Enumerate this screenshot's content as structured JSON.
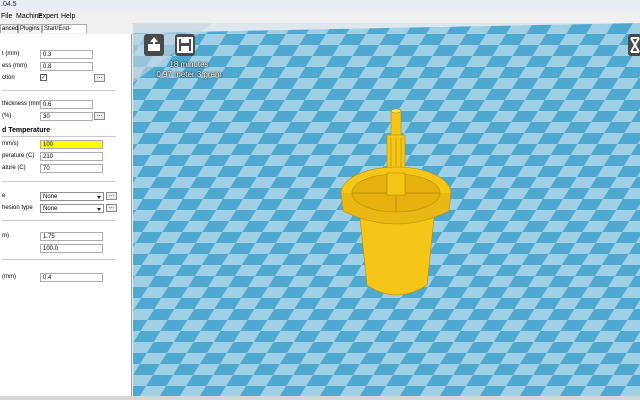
{
  "window": {
    "title": ".04.5"
  },
  "menu": [
    "File",
    "Machine",
    "Expert",
    "Help"
  ],
  "tabs": [
    "anced",
    "Plugins",
    "Start/End-GCode"
  ],
  "settings": {
    "rows": [
      {
        "label": "t (mm)",
        "value": "0.3"
      },
      {
        "label": "ess (mm)",
        "value": "0.8"
      },
      {
        "label": "ction",
        "checked": "✓"
      },
      {
        "label": "thickness (mm)",
        "value": "0.6"
      },
      {
        "label": "(%)",
        "value": "30"
      }
    ],
    "speed_header": "d Temperature",
    "speed_rows": [
      {
        "label": "mm/s)",
        "value": "100"
      },
      {
        "label": "perature (C)",
        "value": "210"
      },
      {
        "label": "ature (C)",
        "value": "70"
      }
    ],
    "support_rows": [
      {
        "label": "e",
        "value": "None"
      },
      {
        "label": "hesion type",
        "value": "None"
      }
    ],
    "filament_rows": [
      {
        "label": "m)",
        "value": "1.75"
      },
      {
        "label": "",
        "value": "100.0"
      }
    ],
    "machine_rows": [
      {
        "label": "(mm)",
        "value": "0.4"
      }
    ],
    "more_button": "..."
  },
  "viewport": {
    "print_time": "18 minutes",
    "print_material": "0.97 meter 3 gram",
    "colors": {
      "floor_light": "#9fd0e6",
      "floor_dark": "#4fa8cf",
      "model": "#f5c518",
      "model_shadow": "#d9a90c"
    }
  },
  "icons": [
    "load-model-icon",
    "save-gcode-icon",
    "view-mode-icon"
  ]
}
